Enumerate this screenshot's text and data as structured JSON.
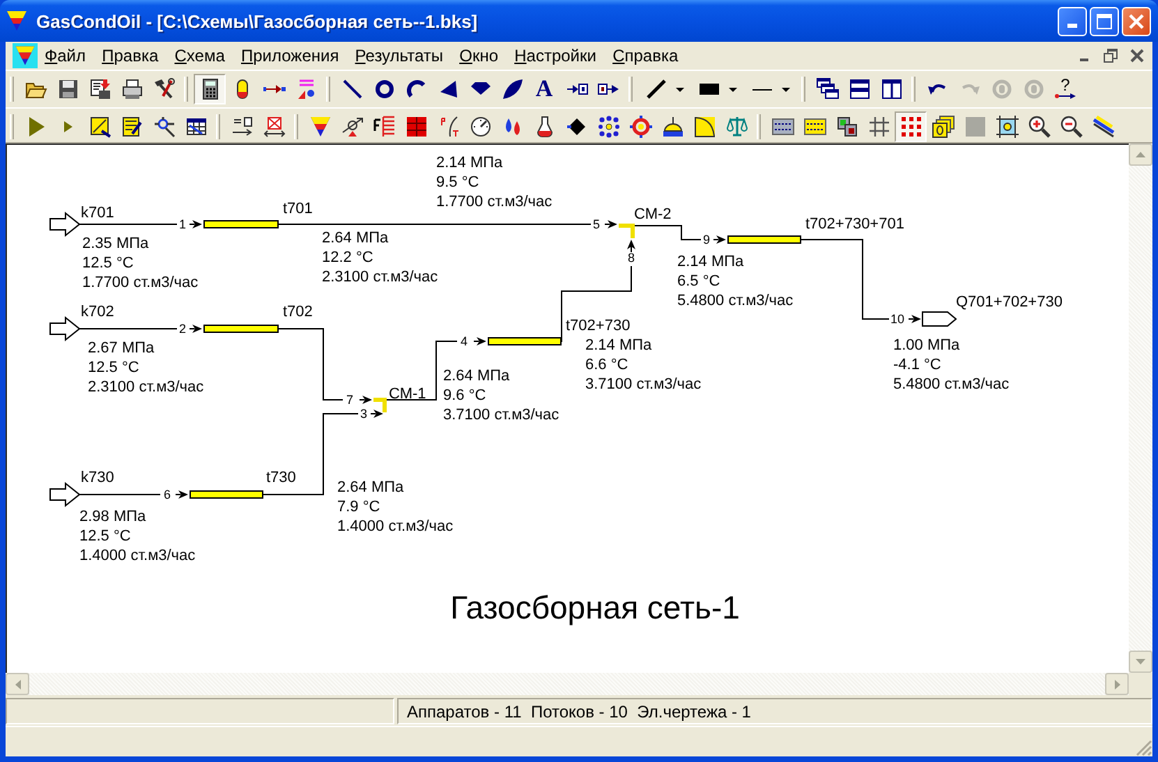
{
  "window": {
    "title": "GasCondOil - [C:\\Схемы\\Газосборная сеть--1.bks]"
  },
  "menu": {
    "items": [
      "Файл",
      "Правка",
      "Схема",
      "Приложения",
      "Результаты",
      "Окно",
      "Настройки",
      "Справка"
    ]
  },
  "toolbars": [
    {
      "groups": [
        [
          {
            "kind": "open",
            "pressed": false,
            "disabled": false
          },
          {
            "kind": "save",
            "pressed": false,
            "disabled": false
          },
          {
            "kind": "save-all",
            "pressed": false,
            "disabled": false
          },
          {
            "kind": "print",
            "pressed": false,
            "disabled": false
          },
          {
            "kind": "tools",
            "pressed": false,
            "disabled": false
          }
        ],
        [
          {
            "kind": "calculator",
            "pressed": true,
            "disabled": false
          },
          {
            "kind": "capsule",
            "pressed": false,
            "disabled": false
          },
          {
            "kind": "connector",
            "pressed": false,
            "disabled": false
          },
          {
            "kind": "text-style",
            "pressed": false,
            "disabled": false
          }
        ],
        [
          {
            "kind": "line",
            "pressed": false,
            "disabled": false
          },
          {
            "kind": "circle",
            "pressed": false,
            "disabled": false
          },
          {
            "kind": "arc",
            "pressed": false,
            "disabled": false
          },
          {
            "kind": "wedge",
            "pressed": false,
            "disabled": false
          },
          {
            "kind": "diamond",
            "pressed": false,
            "disabled": false
          },
          {
            "kind": "leaf",
            "pressed": false,
            "disabled": false
          },
          {
            "kind": "text",
            "glyph": "A",
            "pressed": false,
            "disabled": false
          },
          {
            "kind": "inlet",
            "pressed": false,
            "disabled": false
          },
          {
            "kind": "outlet",
            "pressed": false,
            "disabled": false
          }
        ],
        [
          {
            "kind": "line-style",
            "pressed": false,
            "disabled": false
          },
          {
            "kind": "fill-style",
            "pressed": false,
            "disabled": false
          },
          {
            "kind": "dash-style",
            "pressed": false,
            "disabled": false
          }
        ],
        [
          {
            "kind": "cascade",
            "pressed": false,
            "disabled": false
          },
          {
            "kind": "tile-horizontal",
            "pressed": false,
            "disabled": false
          },
          {
            "kind": "tile-vertical",
            "pressed": false,
            "disabled": false
          }
        ],
        [
          {
            "kind": "undo",
            "pressed": false,
            "disabled": false
          },
          {
            "kind": "redo",
            "pressed": false,
            "disabled": true
          },
          {
            "kind": "rotate-right",
            "pressed": false,
            "disabled": true
          },
          {
            "kind": "rotate-left",
            "pressed": false,
            "disabled": true
          },
          {
            "kind": "help",
            "glyph": "?",
            "pressed": false,
            "disabled": false
          }
        ]
      ]
    },
    {
      "groups": [
        [
          {
            "kind": "run",
            "pressed": false,
            "disabled": false
          },
          {
            "kind": "step",
            "pressed": false,
            "disabled": false
          },
          {
            "kind": "report",
            "pressed": false,
            "disabled": false
          },
          {
            "kind": "notes",
            "pressed": false,
            "disabled": false
          },
          {
            "kind": "network",
            "pressed": false,
            "disabled": false
          },
          {
            "kind": "table",
            "pressed": false,
            "disabled": false
          }
        ],
        [
          {
            "kind": "pt-arrow",
            "pressed": false,
            "disabled": false
          },
          {
            "kind": "delete-cross",
            "pressed": false,
            "disabled": false
          }
        ],
        [
          {
            "kind": "funnel",
            "pressed": false,
            "disabled": false
          },
          {
            "kind": "valve",
            "pressed": false,
            "disabled": false
          },
          {
            "kind": "fractions",
            "pressed": false,
            "disabled": false
          },
          {
            "kind": "red-grid",
            "pressed": false,
            "disabled": false
          },
          {
            "kind": "pt-curve",
            "pressed": false,
            "disabled": false
          },
          {
            "kind": "gauge",
            "pressed": false,
            "disabled": false
          },
          {
            "kind": "drops",
            "pressed": false,
            "disabled": false
          },
          {
            "kind": "flask",
            "pressed": false,
            "disabled": false
          },
          {
            "kind": "black-diamond",
            "pressed": false,
            "disabled": false
          },
          {
            "kind": "dots",
            "pressed": false,
            "disabled": false
          },
          {
            "kind": "target",
            "pressed": false,
            "disabled": false
          },
          {
            "kind": "dome",
            "pressed": false,
            "disabled": false
          },
          {
            "kind": "quarter",
            "pressed": false,
            "disabled": false
          },
          {
            "kind": "scales",
            "pressed": false,
            "disabled": false
          }
        ],
        [
          {
            "kind": "tag-gray",
            "pressed": false,
            "disabled": false
          },
          {
            "kind": "tag-yellow",
            "pressed": false,
            "disabled": false
          },
          {
            "kind": "layers",
            "pressed": false,
            "disabled": false
          },
          {
            "kind": "grid",
            "pressed": false,
            "disabled": false
          },
          {
            "kind": "dot-grid",
            "pressed": true,
            "disabled": false
          },
          {
            "kind": "stack",
            "pressed": false,
            "disabled": false
          },
          {
            "kind": "square",
            "pressed": false,
            "disabled": false
          },
          {
            "kind": "frame",
            "pressed": false,
            "disabled": false
          },
          {
            "kind": "zoom-in",
            "pressed": false,
            "disabled": false
          },
          {
            "kind": "zoom-out",
            "pressed": false,
            "disabled": false
          },
          {
            "kind": "brush",
            "pressed": false,
            "disabled": false
          }
        ]
      ]
    }
  ],
  "scheme": {
    "elements": [
      {
        "kind": "source",
        "name": "k701",
        "readings": [
          "2.35 МПа",
          "12.5 °C",
          "1.7700 ст.м3/час"
        ]
      },
      {
        "kind": "pipe",
        "name": "t701",
        "readings": [
          "2.14 МПа",
          "9.5 °C",
          "1.7700 ст.м3/час"
        ]
      },
      {
        "kind": "mixer",
        "name": "СМ-2",
        "readings": [
          "2.14 МПа",
          "6.5 °C",
          "5.4800 ст.м3/час"
        ]
      },
      {
        "kind": "pipe",
        "name": "t702+730+701",
        "readings": [
          "1.00 МПа",
          "-4.1 °C",
          "5.4800 ст.м3/час"
        ]
      },
      {
        "kind": "sink",
        "name": "Q701+702+730"
      },
      {
        "kind": "source",
        "name": "k702",
        "readings": [
          "2.67 МПа",
          "12.5 °C",
          "2.3100 ст.м3/час"
        ]
      },
      {
        "kind": "pipe",
        "name": "t702",
        "readings": [
          "2.64 МПа",
          "12.2 °C",
          "2.3100 ст.м3/час"
        ]
      },
      {
        "kind": "pipe",
        "name": "t702+730",
        "readings": [
          "2.14 МПа",
          "6.6 °C",
          "3.7100 ст.м3/час"
        ]
      },
      {
        "kind": "mixer",
        "name": "СМ-1",
        "readings": [
          "2.64 МПа",
          "9.6 °C",
          "3.7100 ст.м3/час"
        ]
      },
      {
        "kind": "source",
        "name": "k730",
        "readings": [
          "2.98 МПа",
          "12.5 °C",
          "1.4000 ст.м3/час"
        ]
      },
      {
        "kind": "pipe",
        "name": "t730",
        "readings": [
          "2.64 МПа",
          "7.9 °C",
          "1.4000 ст.м3/час"
        ]
      }
    ],
    "streams": [
      {
        "number": "1"
      },
      {
        "number": "2"
      },
      {
        "number": "3"
      },
      {
        "number": "4"
      },
      {
        "number": "5"
      },
      {
        "number": "6"
      },
      {
        "number": "7"
      },
      {
        "number": "8"
      },
      {
        "number": "9"
      },
      {
        "number": "10"
      }
    ],
    "title": "Газосборная сеть-1"
  },
  "status_bar": {
    "text": "Аппаратов - 11  Потоков - 10  Эл.чертежа - 1"
  }
}
